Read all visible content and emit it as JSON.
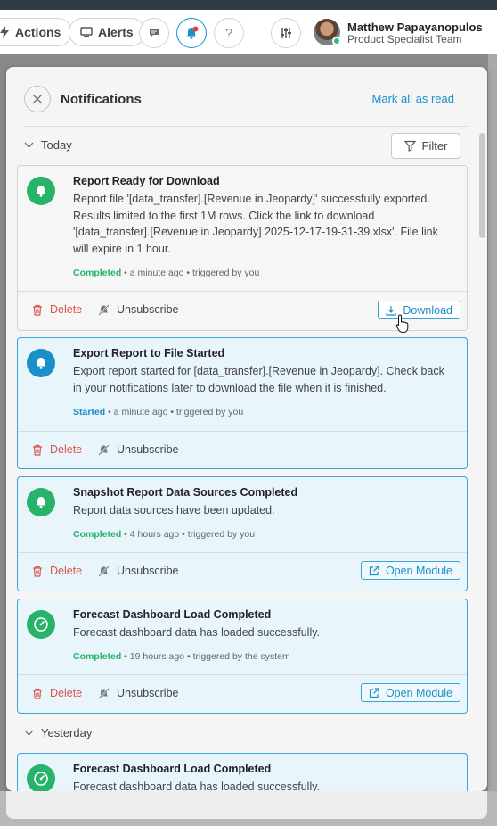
{
  "app_bar": {
    "actions_label": "Actions",
    "alerts_label": "Alerts",
    "user_name": "Matthew Papayanopulos",
    "user_team": "Product Specialist Team"
  },
  "notifications": {
    "title": "Notifications",
    "mark_all_label": "Mark all as read",
    "filter_label": "Filter",
    "delete_label": "Delete",
    "unsubscribe_label": "Unsubscribe",
    "groups": {
      "today": "Today",
      "yesterday": "Yesterday"
    },
    "items": [
      {
        "title": "Report Ready for Download",
        "message": "Report file '[data_transfer].[Revenue in Jeopardy]' successfully exported. Results limited to the first 1M rows. Click the link to download '[data_transfer].[Revenue in Jeopardy] 2025-12-17-19-31-39.xlsx'. File link will expire in 1 hour.",
        "status": "Completed",
        "meta": " • a minute ago • triggered by you",
        "action_label": "Download",
        "icon": "bell-icon",
        "read": true
      },
      {
        "title": "Export Report to File Started",
        "message": "Export report started for [data_transfer].[Revenue in Jeopardy]. Check back in your notifications later to download the file when it is finished.",
        "status": "Started",
        "meta": " • a minute ago • triggered by you",
        "icon": "bell-icon",
        "read": false
      },
      {
        "title": "Snapshot Report Data Sources Completed",
        "message": "Report data sources have been updated.",
        "status": "Completed",
        "meta": " • 4 hours ago • triggered by you",
        "action_label": "Open Module",
        "icon": "bell-icon",
        "read": false
      },
      {
        "title": "Forecast Dashboard Load Completed",
        "message": "Forecast dashboard data has loaded successfully.",
        "status": "Completed",
        "meta": " • 19 hours ago • triggered by the system",
        "action_label": "Open Module",
        "icon": "gauge-icon",
        "read": false
      },
      {
        "title": "Forecast Dashboard Load Completed",
        "message": "Forecast dashboard data has loaded successfully.",
        "icon": "gauge-icon",
        "read": false
      }
    ]
  },
  "colors": {
    "accent": "#1b8fc9",
    "success": "#27b36a",
    "danger": "#d9534f",
    "unread_bg": "#e8f5fb"
  }
}
